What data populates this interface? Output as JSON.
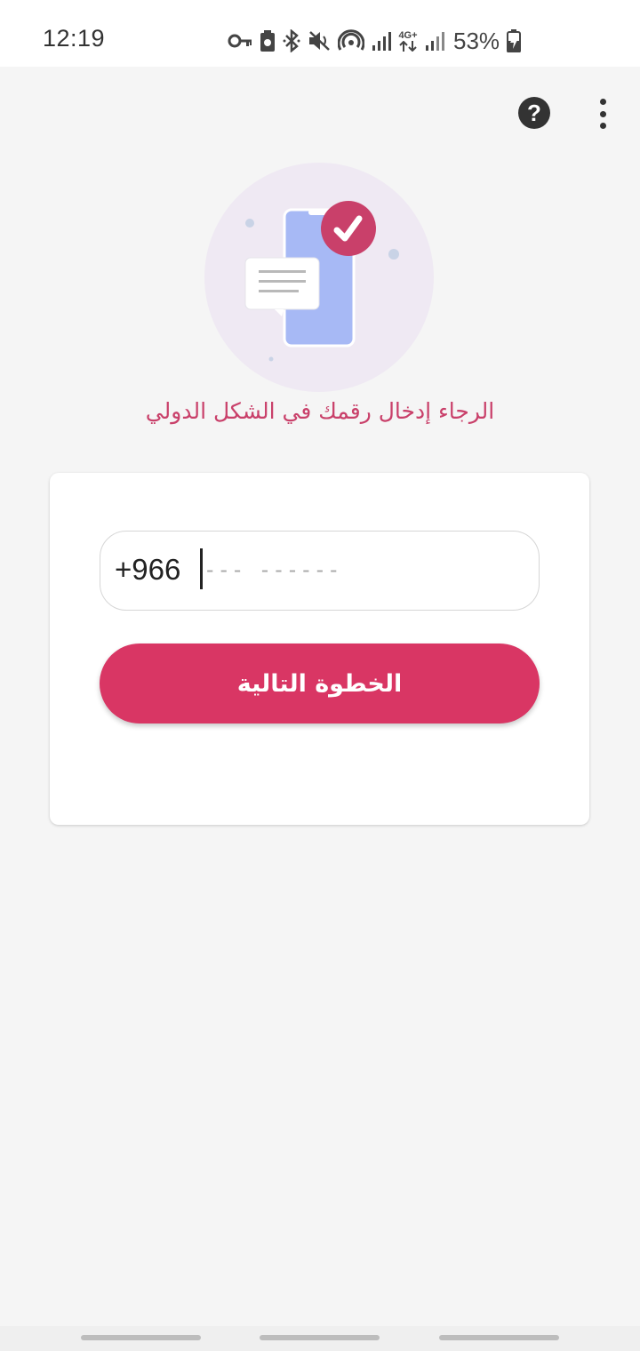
{
  "status_bar": {
    "time": "12:19",
    "battery_percent": "53%",
    "network_label": "4G+",
    "icons": [
      "vpn-key-icon",
      "battery-saver-icon",
      "bluetooth-icon",
      "mute-icon",
      "hotspot-icon",
      "signal-icon",
      "data-arrows-icon",
      "signal-icon-2",
      "battery-charging-icon"
    ]
  },
  "toolbar": {
    "help_icon": "help-circle-icon",
    "help_glyph": "?",
    "overflow_icon": "more-vertical-icon"
  },
  "illustration": {
    "icon": "phone-verified-illustration",
    "colors": {
      "circle": "#efe9f3",
      "phone": "#a7b9f5",
      "check_badge": "#c9406a",
      "bubble": "#ffffff"
    }
  },
  "prompt": {
    "text": "الرجاء إدخال رقمك في الشكل الدولي"
  },
  "form": {
    "country_code": "+966",
    "phone_placeholder": "--- ------",
    "phone_value": "",
    "next_label": "الخطوة التالية"
  },
  "colors": {
    "accent": "#d93664",
    "prompt_text": "#c9406a",
    "background": "#f5f5f5"
  }
}
